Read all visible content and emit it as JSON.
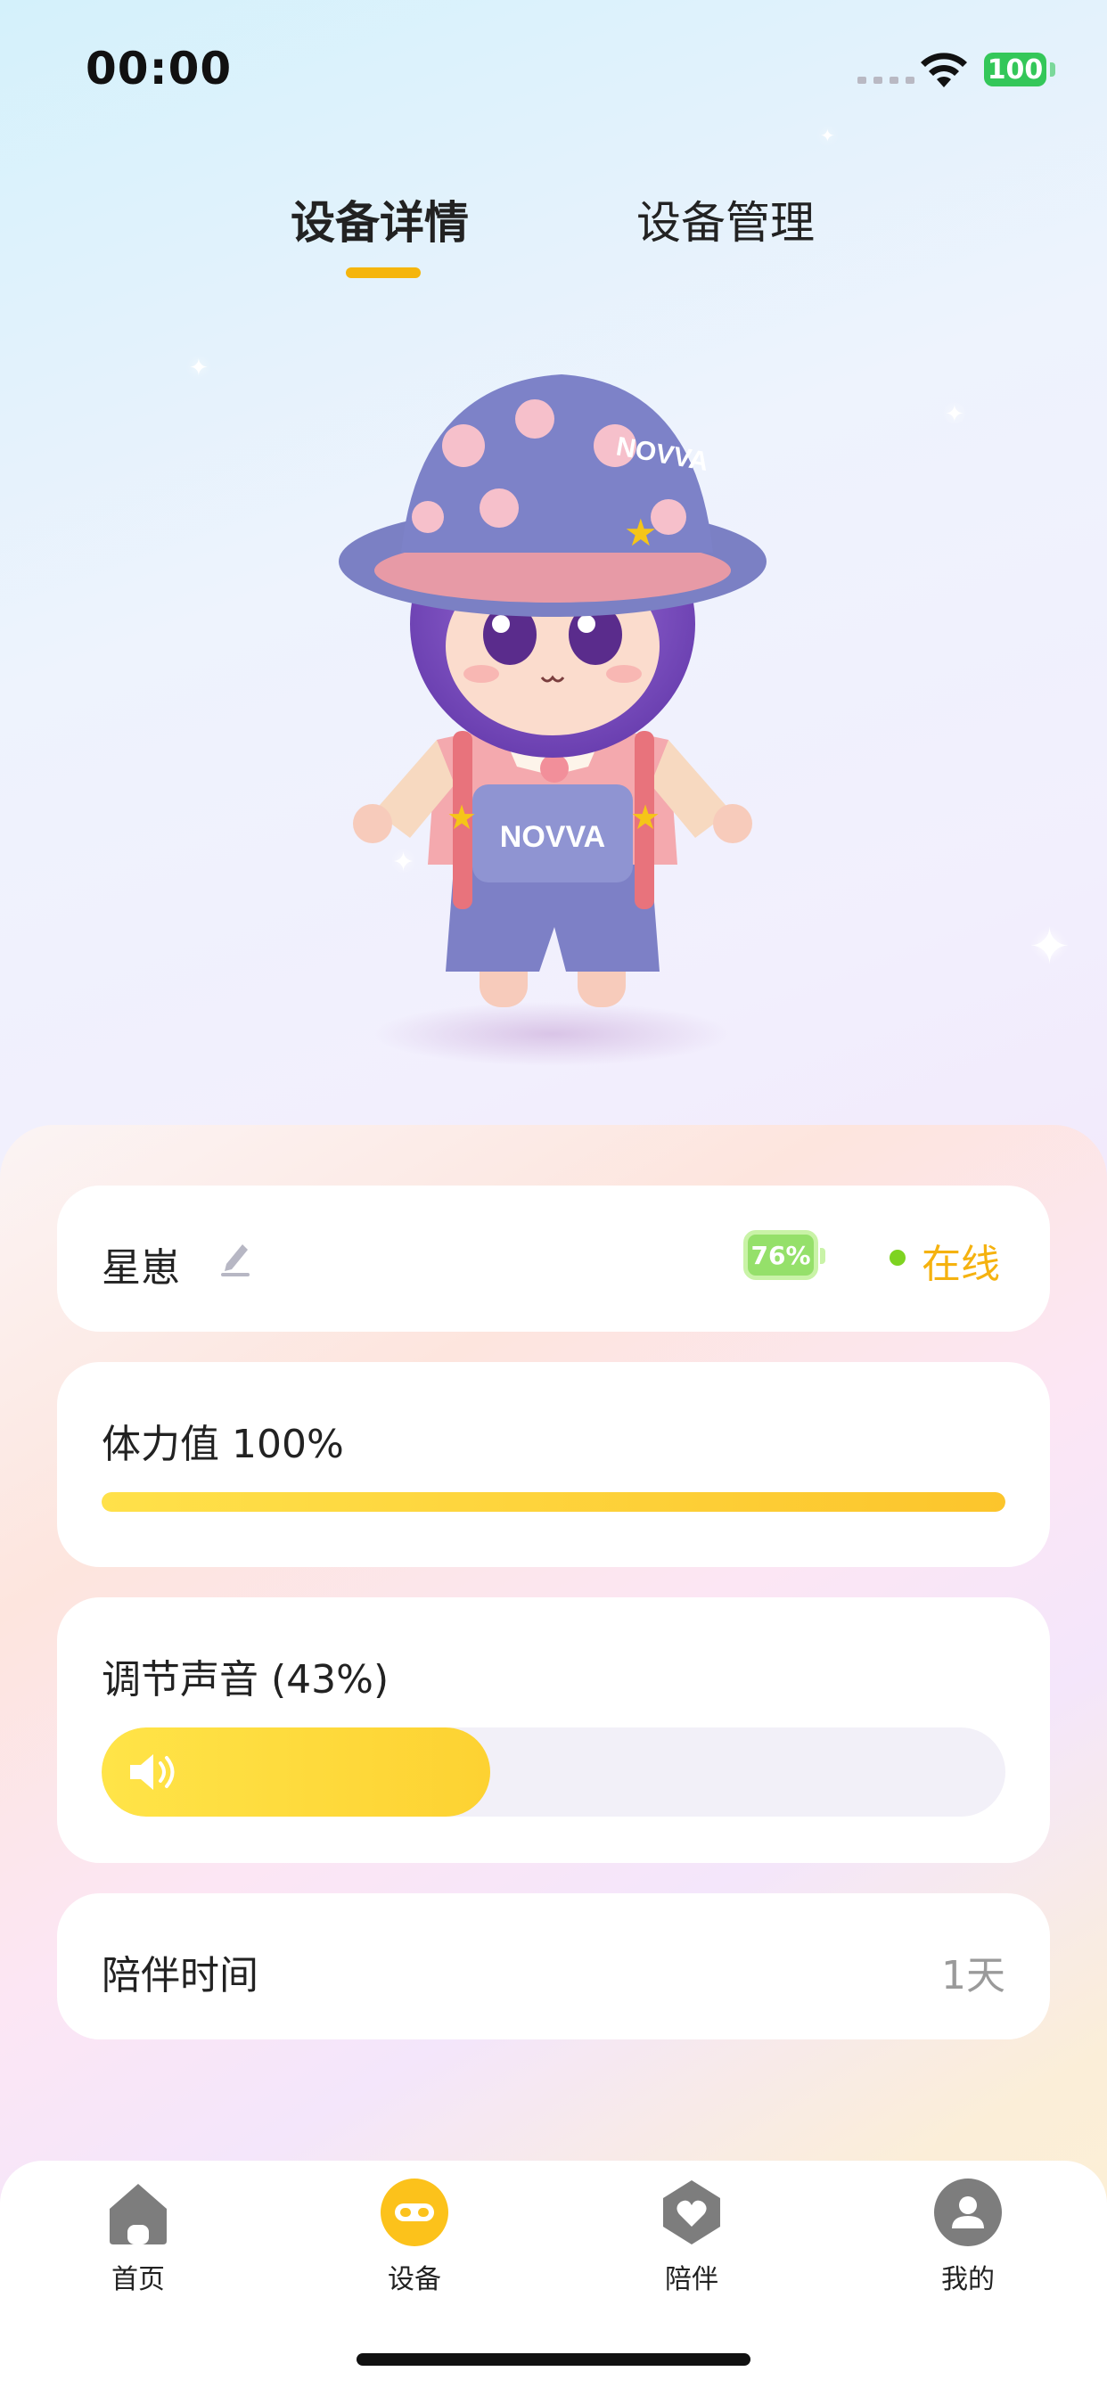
{
  "status_bar": {
    "time": "00:00",
    "battery": "100"
  },
  "tabs": [
    {
      "label": "设备详情",
      "active": true
    },
    {
      "label": "设备管理",
      "active": false
    }
  ],
  "device": {
    "name": "星崽",
    "battery_badge": "76%",
    "status": "在线"
  },
  "stamina": {
    "label": "体力值 100%",
    "value": 1.0
  },
  "volume": {
    "label": "调节声音 (43%)",
    "value": 0.43
  },
  "companion": {
    "label": "陪伴时间",
    "value": "1天"
  },
  "doll": {
    "hat_text": "NOVVA",
    "bib_text": "NOVVA"
  },
  "bottom_nav": [
    {
      "label": "首页",
      "icon": "home-icon"
    },
    {
      "label": "设备",
      "icon": "device-icon",
      "active": true
    },
    {
      "label": "陪伴",
      "icon": "heart-icon"
    },
    {
      "label": "我的",
      "icon": "profile-icon"
    }
  ],
  "colors": {
    "accent": "#f5b50c",
    "online": "#7ed321",
    "battery_green": "#34c759"
  }
}
